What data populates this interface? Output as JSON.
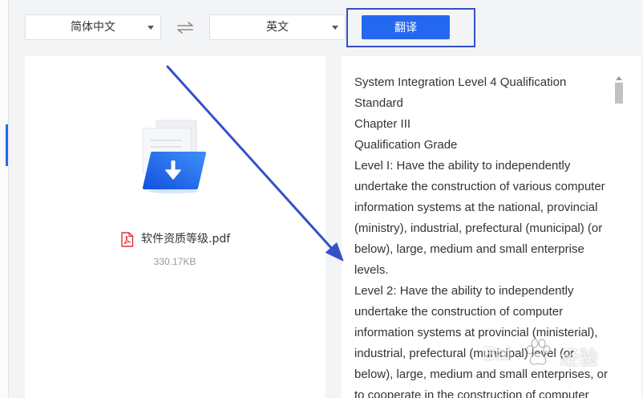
{
  "toolbar": {
    "source_language": "简体中文",
    "target_language": "英文",
    "translate_label": "翻译"
  },
  "upload": {
    "file_name": "软件资质等级.pdf",
    "file_size": "330.17KB"
  },
  "result": {
    "lines": [
      "System Integration Level 4 Qualification",
      "Standard",
      "Chapter III",
      "Qualification Grade",
      "Level I: Have the ability to independently",
      "undertake the construction of various computer",
      "information systems at the national, provincial",
      "(ministry), industrial, prefectural (municipal) (or",
      "below), large, medium and small enterprise",
      "levels.",
      "Level 2: Have the ability to independently",
      "undertake the construction of computer",
      "information systems at provincial (ministerial),",
      "industrial, prefectural (municipal) level (or",
      "below), large, medium and small enterprises, or",
      "to cooperate in the construction of computer"
    ]
  },
  "watermark": {
    "brand": "Bai",
    "label": "经验"
  },
  "icons": {
    "dropdown": "chevron-down-icon",
    "swap": "swap-icon",
    "upload": "upload-folder-icon",
    "file_type": "pdf-file-icon"
  },
  "colors": {
    "accent": "#2468f2",
    "annotation": "#3450c8",
    "file_icon": "#e0302b"
  }
}
